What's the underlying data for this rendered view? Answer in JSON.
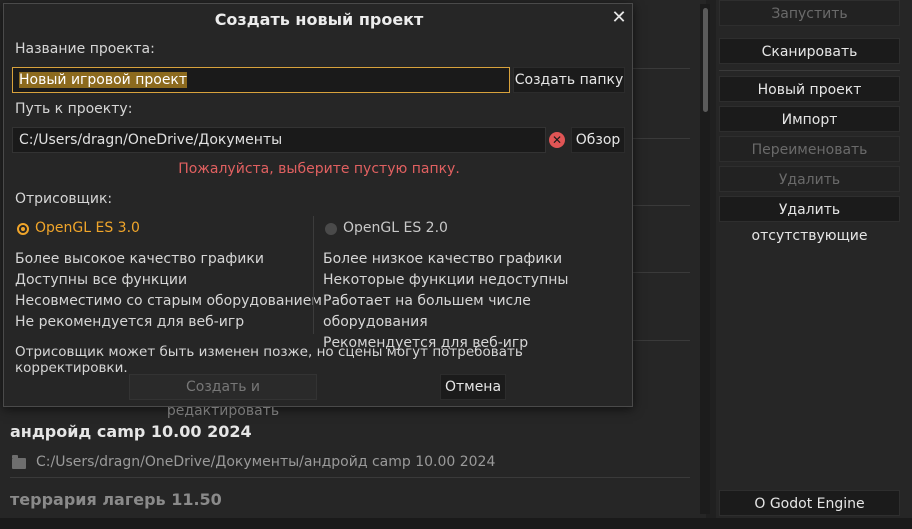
{
  "dialog": {
    "title": "Создать новый проект",
    "project_name_label": "Название проекта:",
    "project_name_value": "Новый игровой проект",
    "create_folder_button": "Создать папку",
    "project_path_label": "Путь к проекту:",
    "project_path_value": "C:/Users/dragn/OneDrive/Документы",
    "browse_button": "Обзор",
    "error_message": "Пожалуйста, выберите пустую папку.",
    "renderer_label": "Отрисовщик:",
    "renderer_options": [
      {
        "label": "OpenGL ES 3.0",
        "selected": true,
        "features": [
          "Более высокое качество графики",
          "Доступны все функции",
          "Несовместимо со старым оборудованием",
          "Не рекомендуется для веб-игр"
        ]
      },
      {
        "label": "OpenGL ES 2.0",
        "selected": false,
        "features": [
          "Более низкое качество графики",
          "Некоторые функции недоступны",
          "Работает на большем числе оборудования",
          "Рекомендуется для веб-игр"
        ]
      }
    ],
    "renderer_note": "Отрисовщик может быть изменен позже, но сцены могут потребовать корректировки.",
    "create_edit_button": "Создать и редактировать",
    "cancel_button": "Отмена"
  },
  "projects": [
    {
      "title": "андройд camp 10.00 2024",
      "path": "C:/Users/dragn/OneDrive/Документы/андройд camp 10.00 2024"
    },
    {
      "title": "террария лагерь 11.50"
    }
  ],
  "right_panel": {
    "run_button": "Запустить",
    "scan_button": "Сканировать",
    "new_project_button": "Новый проект",
    "import_button": "Импорт",
    "rename_button": "Переименовать",
    "delete_button": "Удалить",
    "delete_missing_button": "Удалить отсутствующие",
    "about_button": "О Godot Engine"
  },
  "colors": {
    "accent": "#f0a52a",
    "error": "#e06060",
    "background": "#202020"
  }
}
